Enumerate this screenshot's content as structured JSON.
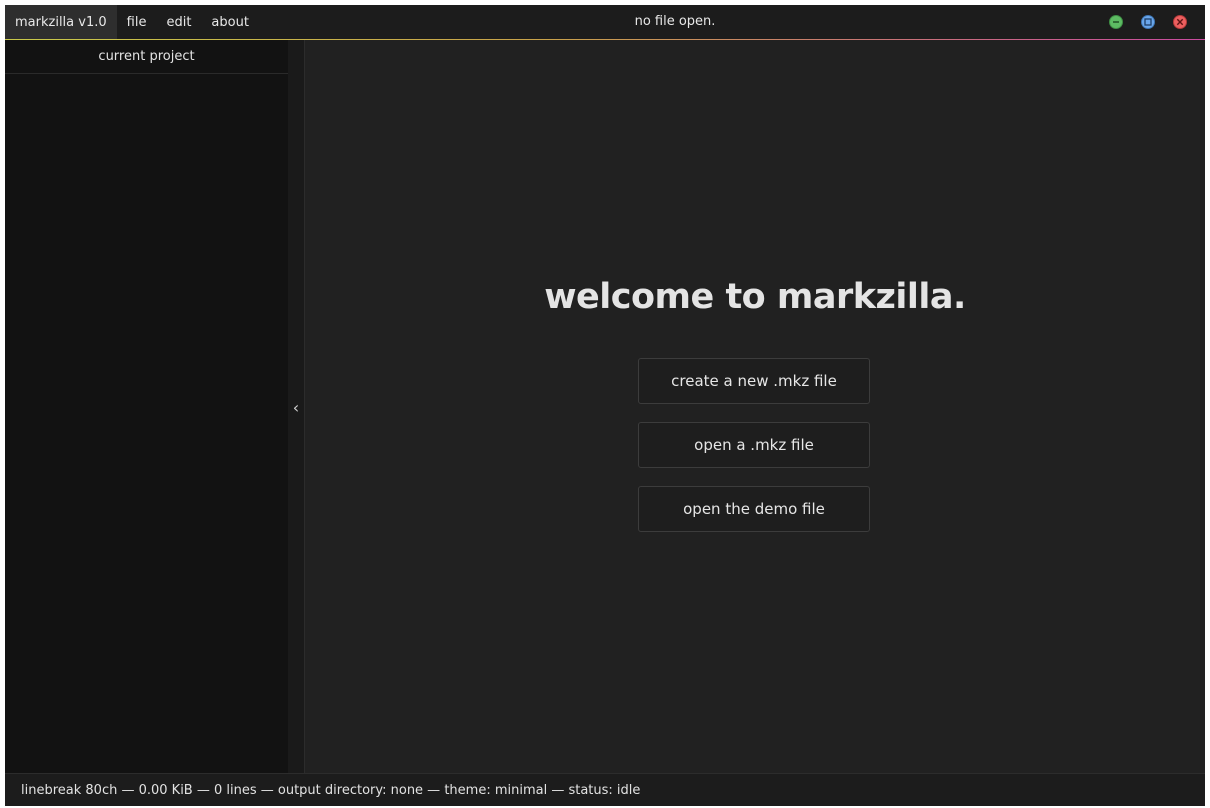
{
  "menubar": {
    "app_label": "markzilla v1.0",
    "items": [
      "file",
      "edit",
      "about"
    ]
  },
  "window": {
    "title": "no file open."
  },
  "window_controls": {
    "icons": [
      "minimize-icon",
      "maximize-icon",
      "close-icon"
    ],
    "colors": {
      "minimize": "#5dbb63",
      "maximize": "#6aa6ea",
      "close": "#ec5f5f"
    }
  },
  "sidebar": {
    "header": "current project",
    "collapse_glyph": "‹"
  },
  "main": {
    "welcome": "welcome to markzilla.",
    "buttons": [
      "create a new .mkz file",
      "open a .mkz file",
      "open the demo file"
    ]
  },
  "statusbar": {
    "text": "linebreak 80ch — 0.00 KiB — 0 lines — output directory: none — theme: minimal — status: idle"
  },
  "colors": {
    "background": "#212121",
    "sidebar": "#121212",
    "accent_gradient": [
      "#c9c94a",
      "#c84aa0"
    ]
  }
}
